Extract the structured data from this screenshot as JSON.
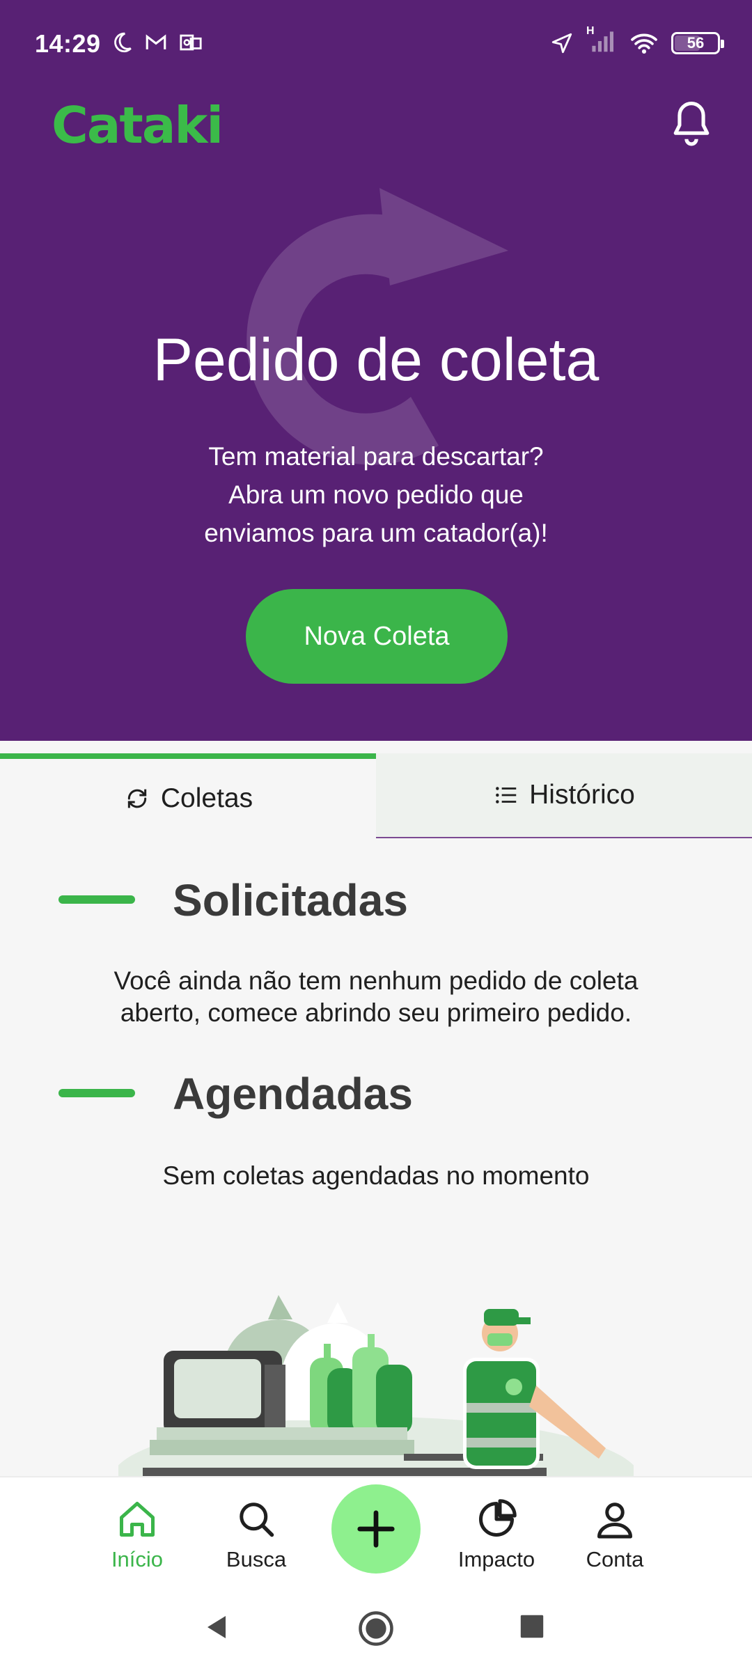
{
  "status_bar": {
    "time": "14:29",
    "battery": "56",
    "network": "H"
  },
  "header": {
    "logo": "Cataki"
  },
  "hero": {
    "title": "Pedido de coleta",
    "subtitle_line1": "Tem material para descartar?",
    "subtitle_line2": "Abra um novo pedido que",
    "subtitle_line3": "enviamos para um catador(a)!",
    "button_label": "Nova Coleta"
  },
  "tabs": [
    {
      "label": "Coletas",
      "active": true
    },
    {
      "label": "Histórico",
      "active": false
    }
  ],
  "sections": {
    "requested": {
      "title": "Solicitadas",
      "text_line1": "Você ainda não tem nenhum pedido de coleta",
      "text_line2": "aberto, comece abrindo seu primeiro pedido."
    },
    "scheduled": {
      "title": "Agendadas",
      "text": "Sem coletas agendadas no momento"
    }
  },
  "bottom_nav": [
    {
      "label": "Início",
      "icon": "home-icon",
      "active": true
    },
    {
      "label": "Busca",
      "icon": "search-icon",
      "active": false
    },
    {
      "label": "",
      "icon": "plus-icon",
      "active": false
    },
    {
      "label": "Impacto",
      "icon": "pie-chart-icon",
      "active": false
    },
    {
      "label": "Conta",
      "icon": "user-icon",
      "active": false
    }
  ],
  "colors": {
    "hero_background": "#582174",
    "brand_green": "#3bb54a",
    "fab": "#8ef08e"
  }
}
